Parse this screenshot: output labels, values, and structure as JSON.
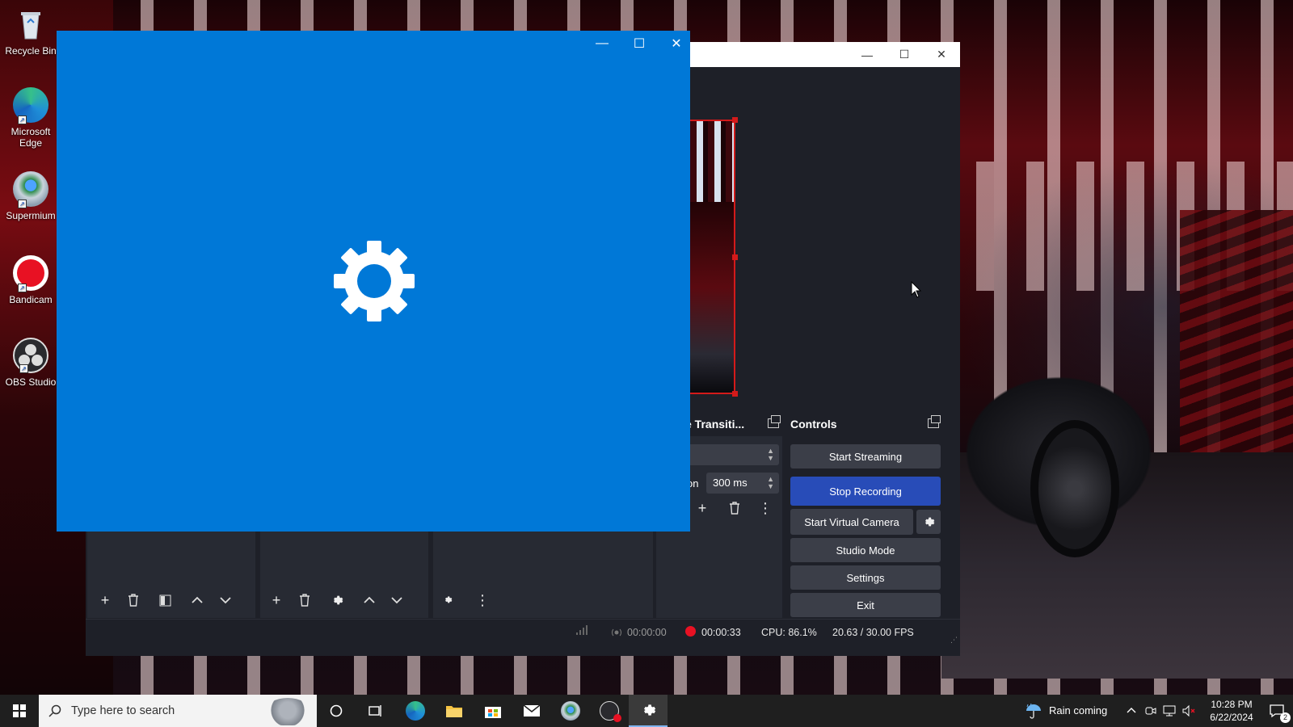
{
  "desktop": {
    "icons": [
      {
        "label": "Recycle Bin",
        "icon": "recycle-bin-icon"
      },
      {
        "label": "Microsoft Edge",
        "icon": "edge-icon"
      },
      {
        "label": "Supermium",
        "icon": "supermium-icon"
      },
      {
        "label": "Bandicam",
        "icon": "bandicam-icon"
      },
      {
        "label": "OBS Studio",
        "icon": "obs-icon"
      }
    ]
  },
  "obs": {
    "transitions_title": "e Transiti...",
    "duration_prefix": "on",
    "duration_value": "300 ms",
    "controls_title": "Controls",
    "controls": {
      "start_streaming": "Start Streaming",
      "stop_recording": "Stop Recording",
      "start_virtual_camera": "Start Virtual Camera",
      "studio_mode": "Studio Mode",
      "settings": "Settings",
      "exit": "Exit"
    },
    "status": {
      "stream_time": "00:00:00",
      "rec_time": "00:00:33",
      "cpu": "CPU: 86.1%",
      "fps": "20.63 / 30.00 FPS"
    },
    "colors": {
      "accent": "#284cb8",
      "record": "#e81123",
      "bg": "#1e2028"
    }
  },
  "splash": {
    "icon": "gear-icon",
    "color": "#0078d7"
  },
  "taskbar": {
    "search_placeholder": "Type here to search",
    "weather": "Rain coming",
    "time": "10:28 PM",
    "date": "6/22/2024",
    "notification_count": "2"
  }
}
